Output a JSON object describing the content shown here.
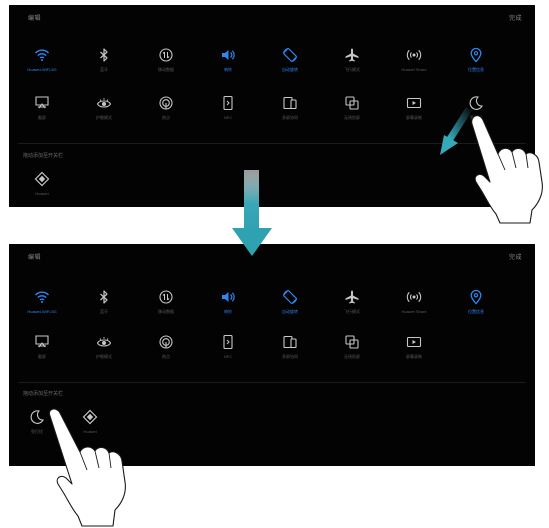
{
  "colors": {
    "panel_bg": "#030303",
    "icon_active": "#2f86f2",
    "icon_inactive": "#c7c7c7",
    "arrow": "#35a9b8"
  },
  "top_panel": {
    "header_left": "编辑",
    "header_right": "完成",
    "row1": [
      {
        "icon": "wifi-icon",
        "label": "Huawei-WiFi-5G",
        "active": true
      },
      {
        "icon": "bluetooth-icon",
        "label": "蓝牙",
        "active": false
      },
      {
        "icon": "mobile-data-icon",
        "label": "移动数据",
        "active": false
      },
      {
        "icon": "sound-icon",
        "label": "响铃",
        "active": true
      },
      {
        "icon": "auto-rotate-icon",
        "label": "自动旋转",
        "active": true
      },
      {
        "icon": "airplane-icon",
        "label": "飞行模式",
        "active": false
      },
      {
        "icon": "hotspot-icon",
        "label": "Huawei Share",
        "active": false
      },
      {
        "icon": "location-icon",
        "label": "位置信息",
        "active": true
      }
    ],
    "row2": [
      {
        "icon": "screenshot-icon",
        "label": "截屏",
        "active": false
      },
      {
        "icon": "eye-comfort-icon",
        "label": "护眼模式",
        "active": false
      },
      {
        "icon": "nfc-icon",
        "label": "热点",
        "active": false
      },
      {
        "icon": "nfc-card-icon",
        "label": "NFC",
        "active": false
      },
      {
        "icon": "multi-screen-icon",
        "label": "多屏协同",
        "active": false
      },
      {
        "icon": "screen-cast-icon",
        "label": "无线投屏",
        "active": false
      },
      {
        "icon": "screen-record-icon",
        "label": "屏幕录制",
        "active": false
      },
      {
        "icon": "moon-icon",
        "label": "免打扰",
        "active": false
      }
    ],
    "section_label": "拖动添加至开关栏",
    "hidden": [
      {
        "icon": "diamond-icon",
        "label": "Huawei",
        "active": false
      }
    ]
  },
  "bottom_panel": {
    "header_left": "编辑",
    "header_right": "完成",
    "row1": [
      {
        "icon": "wifi-icon",
        "label": "Huawei-WiFi-5G",
        "active": true
      },
      {
        "icon": "bluetooth-icon",
        "label": "蓝牙",
        "active": false
      },
      {
        "icon": "mobile-data-icon",
        "label": "移动数据",
        "active": false
      },
      {
        "icon": "sound-icon",
        "label": "响铃",
        "active": true
      },
      {
        "icon": "auto-rotate-icon",
        "label": "自动旋转",
        "active": true
      },
      {
        "icon": "airplane-icon",
        "label": "飞行模式",
        "active": false
      },
      {
        "icon": "hotspot-icon",
        "label": "Huawei Share",
        "active": false
      },
      {
        "icon": "location-icon",
        "label": "位置信息",
        "active": true
      }
    ],
    "row2": [
      {
        "icon": "screenshot-icon",
        "label": "截屏",
        "active": false
      },
      {
        "icon": "eye-comfort-icon",
        "label": "护眼模式",
        "active": false
      },
      {
        "icon": "nfc-icon",
        "label": "热点",
        "active": false
      },
      {
        "icon": "nfc-card-icon",
        "label": "NFC",
        "active": false
      },
      {
        "icon": "multi-screen-icon",
        "label": "多屏协同",
        "active": false
      },
      {
        "icon": "screen-cast-icon",
        "label": "无线投屏",
        "active": false
      },
      {
        "icon": "screen-record-icon",
        "label": "屏幕录制",
        "active": false
      }
    ],
    "section_label": "拖动添加至开关栏",
    "hidden": [
      {
        "icon": "moon-icon",
        "label": "免打扰",
        "active": false
      },
      {
        "icon": "diamond-icon",
        "label": "Huawei",
        "active": false
      }
    ]
  }
}
